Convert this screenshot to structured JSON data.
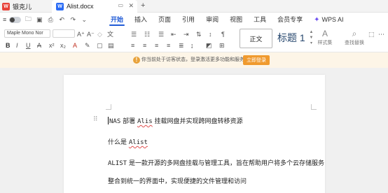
{
  "titlebar": {
    "user_label": "银克儿",
    "doc_tab": "Alist.docx",
    "add_tab": "+"
  },
  "quick_access": {
    "icons": [
      "home-icon",
      "folder-icon",
      "save-icon",
      "print-icon",
      "undo-icon",
      "redo-icon"
    ]
  },
  "menu": {
    "tabs": [
      "开始",
      "插入",
      "页面",
      "引用",
      "审阅",
      "视图",
      "工具",
      "会员专享"
    ],
    "active": "开始",
    "wps_ai": "WPS AI"
  },
  "ribbon": {
    "font_name": "Maple Mono Nor",
    "font_size": "",
    "style_normal": "正文",
    "style_heading": "标题 1",
    "styles_set_label": "样式集",
    "find_replace_label": "查找替换"
  },
  "notice": {
    "text": "你当前处于访客状态，登录激活更多功能和服务。",
    "login_button": "立即登录"
  },
  "document": {
    "line1_prefix": "NAS",
    "line1_mid1": " 部署 ",
    "line1_word": "Alis",
    "line1_rest": " 挂载网盘并实现跨网盘转移资源",
    "line2_prefix": "什么是 ",
    "line2_word": "Alist",
    "line3_word": "ALIST",
    "line3_rest": " 是一款开源的多网盘挂载与管理工具，旨在帮助用户将多个云存储服务",
    "line4": "整合到统一的界面中，实现便捷的文件管理和访问"
  },
  "colors": {
    "accent": "#1f5ad6",
    "notice_bg": "#fdf5e7",
    "login_btn": "#f09a2e",
    "workspace": "#f0f0f0"
  }
}
